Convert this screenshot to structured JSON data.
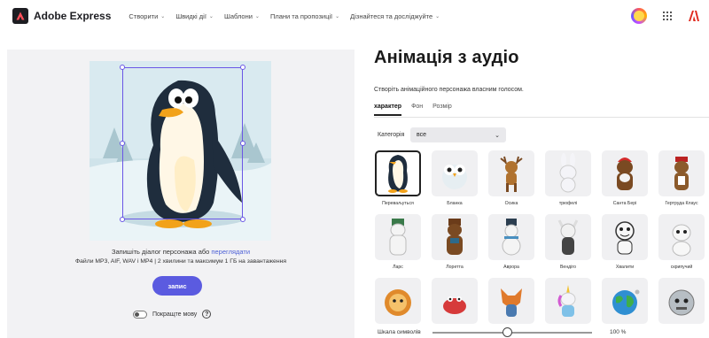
{
  "app": {
    "name": "Adobe Express"
  },
  "nav": {
    "items": [
      {
        "label": "Створити"
      },
      {
        "label": "Швидкі дії"
      },
      {
        "label": "Шаблони"
      },
      {
        "label": "Плани та пропозиції"
      },
      {
        "label": "Дізнайтеся та досліджуйте"
      }
    ]
  },
  "left_panel": {
    "dialog_hint": "Запишіть діалог персонажа або",
    "dialog_link": "переглядати",
    "file_hint": "Файли MP3, AIF, WAV і MP4 | 2 хвилини та максимум 1 ГБ на завантаження",
    "record_button": "запис",
    "improve_label": "Покращте мову",
    "help_glyph": "?"
  },
  "right_panel": {
    "title": "Анімація з аудіо",
    "subtitle": "Створіть анімаційного персонажа власним голосом.",
    "tabs": [
      {
        "label": "характер",
        "active": true
      },
      {
        "label": "Фон",
        "active": false
      },
      {
        "label": "Розмір",
        "active": false
      }
    ],
    "category_label": "Категорія",
    "category_value": "все",
    "characters": [
      {
        "label": "Переваљуться",
        "icon": "penguin-icon",
        "selected": true
      },
      {
        "label": "Бланка",
        "icon": "owl-icon"
      },
      {
        "label": "Осика",
        "icon": "deer-icon"
      },
      {
        "label": "трюфелі",
        "icon": "rabbit-icon"
      },
      {
        "label": "Санта Бері",
        "icon": "santa-bear-icon"
      },
      {
        "label": "Гертруда Клаус",
        "icon": "reindeer-icon"
      },
      {
        "label": "Ларс",
        "icon": "polar-bear-icon"
      },
      {
        "label": "Лоретта",
        "icon": "brown-bear-icon"
      },
      {
        "label": "Аврора",
        "icon": "snowman-icon"
      },
      {
        "label": "Вендіго",
        "icon": "skull-deer-icon"
      },
      {
        "label": "Хвалити",
        "icon": "snowman-face-icon"
      },
      {
        "label": "скрипучий",
        "icon": "snow-cat-icon"
      },
      {
        "label": "",
        "icon": "lion-icon"
      },
      {
        "label": "",
        "icon": "crab-icon"
      },
      {
        "label": "",
        "icon": "fox-icon"
      },
      {
        "label": "",
        "icon": "unicorn-icon"
      },
      {
        "label": "",
        "icon": "earth-icon"
      },
      {
        "label": "",
        "icon": "robot-icon"
      }
    ],
    "scale_label": "Шкала символів",
    "scale_value": "100 %",
    "scale_fraction": 0.47
  }
}
